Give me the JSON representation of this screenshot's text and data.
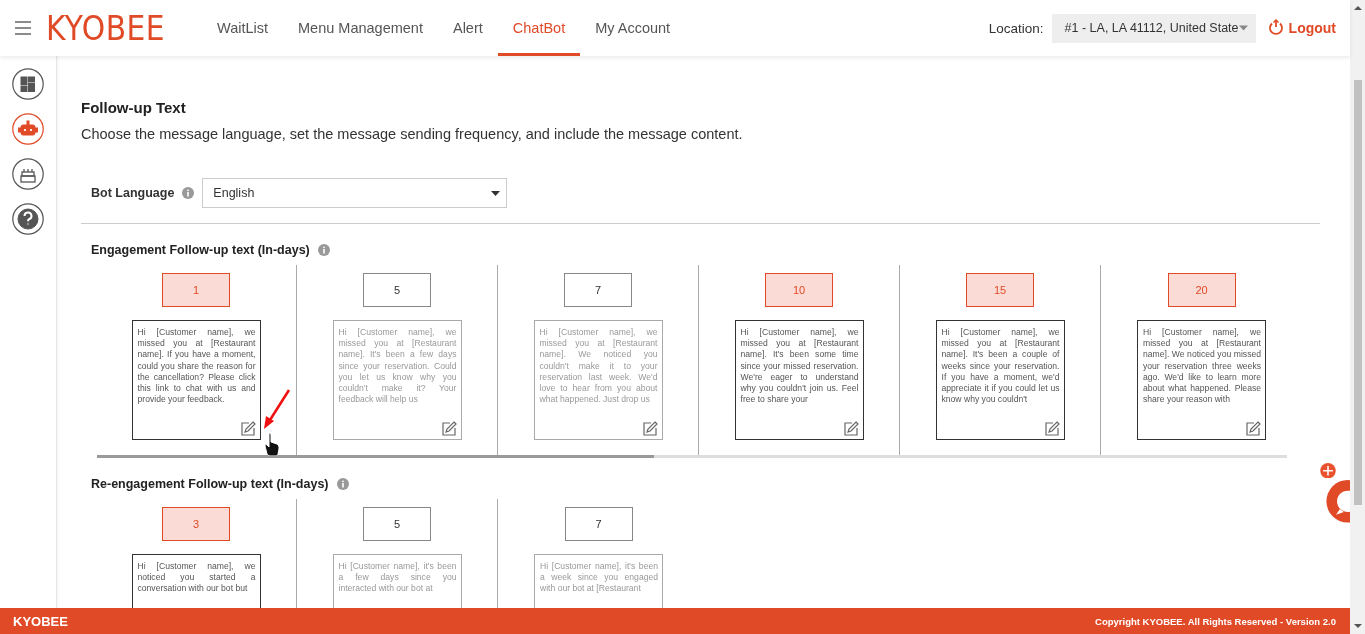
{
  "header": {
    "logo": "KYOBEE",
    "nav": [
      {
        "label": "WaitList",
        "selected": false
      },
      {
        "label": "Menu Management",
        "selected": false
      },
      {
        "label": "Alert",
        "selected": false
      },
      {
        "label": "ChatBot",
        "selected": true
      },
      {
        "label": "My Account",
        "selected": false
      }
    ],
    "location_label": "Location:",
    "location_value": "#1 - LA, LA 41112, United State",
    "logout": "Logout"
  },
  "sidebar": {
    "items": [
      {
        "kind": "dashboard",
        "selected": false
      },
      {
        "kind": "robot",
        "selected": true
      },
      {
        "kind": "cake",
        "selected": false
      },
      {
        "kind": "help",
        "selected": false
      }
    ]
  },
  "page": {
    "title": "Follow-up Text",
    "description": "Choose the message language, set the message sending frequency, and include the message content.",
    "bot_language": {
      "label": "Bot Language",
      "value": "English"
    }
  },
  "sections": [
    {
      "title": "Engagement Follow-up text (In-days)",
      "columns": [
        {
          "day": "1",
          "selected": true,
          "message": "Hi [Customer name], we missed you at [Restaurant name]. If you have a moment, could you share the reason for the cancellation? Please click this link to chat with us and provide your feedback."
        },
        {
          "day": "5",
          "selected": false,
          "message": "Hi [Customer name], we missed you at [Restaurant name]. It's been a few days since your reservation. Could you let us know why you couldn't make it? Your feedback will help us"
        },
        {
          "day": "7",
          "selected": false,
          "message": "Hi [Customer name], we missed you at [Restaurant name]. We noticed you couldn't make it to your reservation last week. We'd love to hear from you about what happened. Just drop us"
        },
        {
          "day": "10",
          "selected": true,
          "message": "Hi [Customer name], we missed you at [Restaurant name]. It's been some time since your missed reservation. We're eager to understand why you couldn't join us. Feel free to share your"
        },
        {
          "day": "15",
          "selected": true,
          "message": "Hi [Customer name], we missed you at [Restaurant name]. It's been a couple of weeks since your reservation. If you have a moment, we'd appreciate it if you could let us know why you couldn't"
        },
        {
          "day": "20",
          "selected": true,
          "message": "Hi [Customer name], we missed you at [Restaurant name]. We noticed you missed your reservation three weeks ago. We'd like to learn more about what happened. Please share your reason with"
        }
      ]
    },
    {
      "title": "Re-engagement Follow-up text (In-days)",
      "columns": [
        {
          "day": "3",
          "selected": true,
          "message": "Hi [Customer name], we noticed you started a conversation with our bot but"
        },
        {
          "day": "5",
          "selected": false,
          "message": "Hi [Customer name], it's been a few days since you interacted with our bot at"
        },
        {
          "day": "7",
          "selected": false,
          "message": "Hi [Customer name], it's been a week since you engaged with our bot at [Restaurant"
        }
      ]
    }
  ],
  "footer": {
    "brand": "KYOBEE",
    "copyright": "Copyright KYOBEE. All Rights Reserved - Version 2.0"
  }
}
